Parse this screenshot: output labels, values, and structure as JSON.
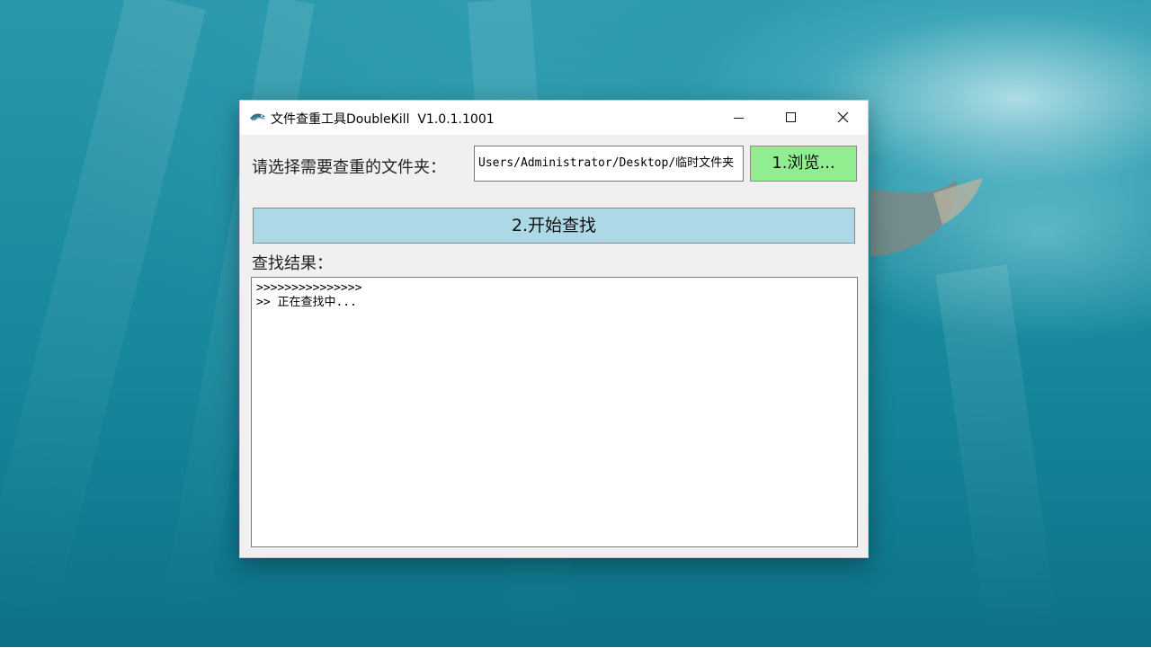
{
  "window": {
    "title": "文件查重工具DoubleKill  V1.0.1.1001",
    "controls": {
      "minimize_icon": "minimize-icon",
      "maximize_icon": "maximize-icon",
      "close_icon": "close-icon"
    }
  },
  "folder_select": {
    "label": "请选择需要查重的文件夹：",
    "path_value": "Users/Administrator/Desktop/临时文件夹",
    "browse_label": "1.浏览..."
  },
  "start_button": {
    "label": "2.开始查找"
  },
  "results": {
    "label": "查找结果：",
    "lines": [
      ">>>>>>>>>>>>>>>",
      ">> 正在查找中..."
    ]
  },
  "colors": {
    "browse_button_bg": "#90ee90",
    "start_button_bg": "#add8e6",
    "window_bg": "#f0f0f0",
    "titlebar_bg": "#ffffff"
  }
}
